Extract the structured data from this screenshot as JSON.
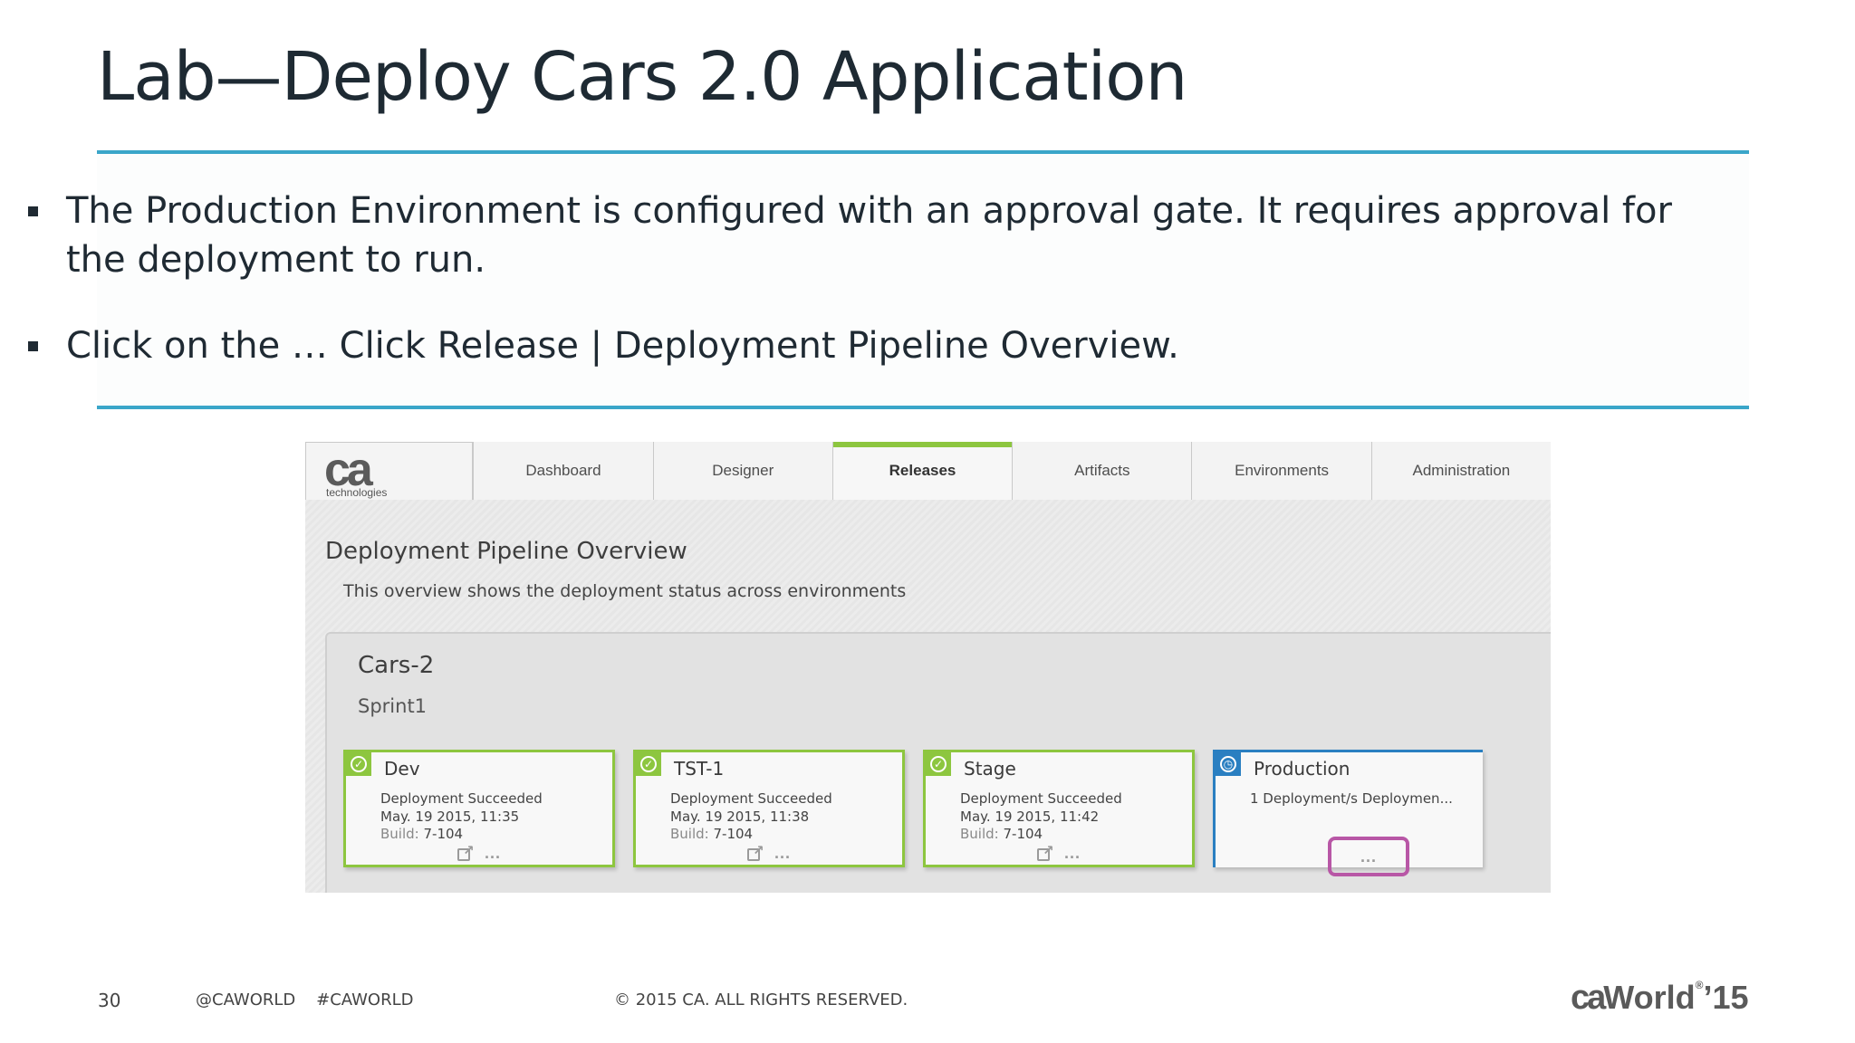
{
  "slide": {
    "title": "Lab—Deploy Cars 2.0 Application",
    "bullets": [
      "The Production Environment is configured with an approval gate. It requires approval for the deployment to run.",
      "Click on the … Click Release | Deployment Pipeline Overview."
    ]
  },
  "app": {
    "logo": {
      "mark": "ca",
      "subtitle": "technologies"
    },
    "nav": [
      {
        "label": "Dashboard",
        "active": false
      },
      {
        "label": "Designer",
        "active": false
      },
      {
        "label": "Releases",
        "active": true
      },
      {
        "label": "Artifacts",
        "active": false
      },
      {
        "label": "Environments",
        "active": false
      },
      {
        "label": "Administration",
        "active": false
      }
    ],
    "page": {
      "heading": "Deployment Pipeline Overview",
      "description": "This overview shows the deployment status across environments"
    },
    "release": {
      "name": "Cars-2",
      "sprint": "Sprint1",
      "environments": [
        {
          "name": "Dev",
          "status": "Deployment Succeeded",
          "date": "May. 19 2015, 11:35",
          "build_label": "Build:",
          "build": "7-104",
          "state_icon": "check-icon"
        },
        {
          "name": "TST-1",
          "status": "Deployment Succeeded",
          "date": "May. 19 2015, 11:38",
          "build_label": "Build:",
          "build": "7-104",
          "state_icon": "check-icon"
        },
        {
          "name": "Stage",
          "status": "Deployment Succeeded",
          "date": "May. 19 2015, 11:42",
          "build_label": "Build:",
          "build": "7-104",
          "state_icon": "check-icon"
        },
        {
          "name": "Production",
          "status": "1 Deployment/s Deploymen...",
          "state_icon": "clock-icon"
        }
      ],
      "more_label": "...",
      "colors": {
        "success": "#8dc63f",
        "pending": "#2a7fc1",
        "highlight": "#b857a6"
      }
    }
  },
  "footer": {
    "page_number": "30",
    "social": "@CAWORLD    #CAWORLD",
    "copyright": "© 2015 CA. ALL RIGHTS RESERVED.",
    "brand": {
      "ca": "ca",
      "world": "World",
      "reg": "®",
      "year": "’15"
    }
  },
  "colors": {
    "accent_rule": "#3aa6c9",
    "title_text": "#1e2a33"
  }
}
